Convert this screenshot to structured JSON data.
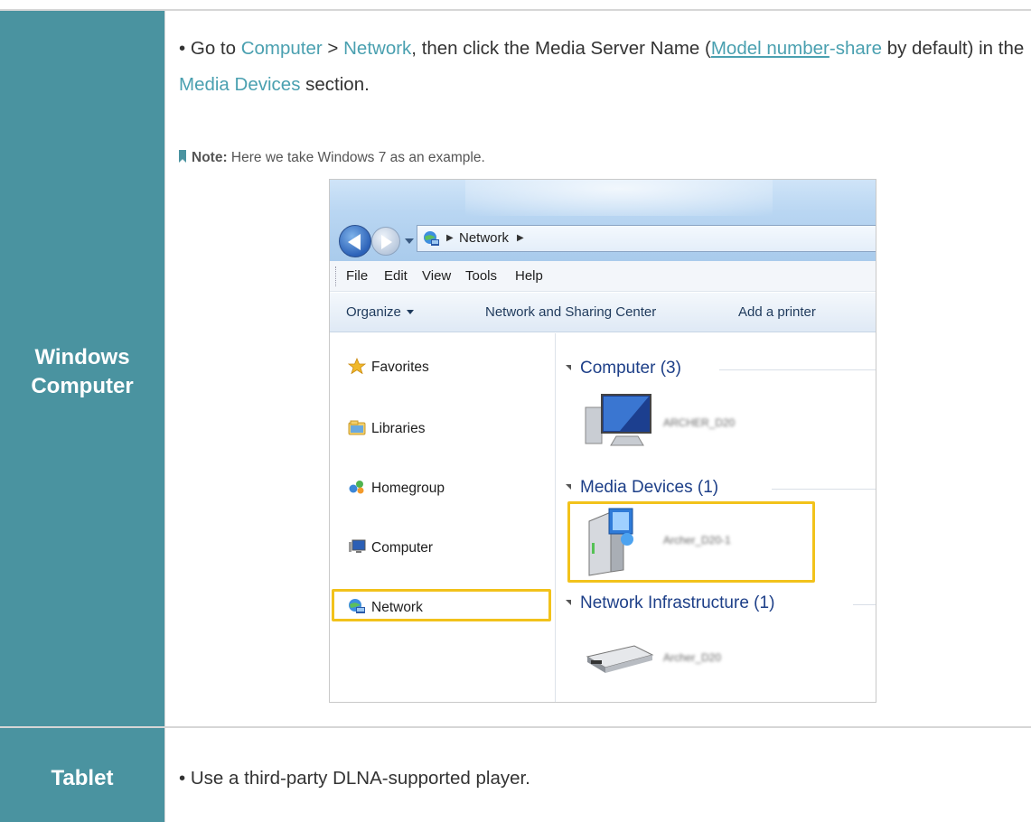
{
  "rows": [
    {
      "category": "Windows Computer",
      "bullet": {
        "parts": [
          {
            "text": "Go to ",
            "style": "plain"
          },
          {
            "text": "Computer",
            "style": "hl"
          },
          {
            "text": " > ",
            "style": "plain"
          },
          {
            "text": "Network",
            "style": "hl"
          },
          {
            "text": ", then click the Media Server Name (",
            "style": "plain"
          },
          {
            "text": "Model number",
            "style": "hl-u"
          },
          {
            "text": "-share",
            "style": "hl"
          },
          {
            "text": " by default) in the ",
            "style": "plain"
          },
          {
            "text": "Media Devices",
            "style": "hl"
          },
          {
            "text": " section.",
            "style": "plain"
          }
        ]
      },
      "note": {
        "label": "Note:",
        "text": "Here we take Windows 7 as an example."
      }
    },
    {
      "category": "Tablet",
      "bullet": {
        "parts": [
          {
            "text": "Use a third-party DLNA-supported player.",
            "style": "plain"
          }
        ]
      }
    }
  ],
  "screenshot": {
    "address_bar": {
      "location": "Network"
    },
    "menu": [
      "File",
      "Edit",
      "View",
      "Tools",
      "Help"
    ],
    "commands": {
      "organize": "Organize",
      "network_sharing": "Network and Sharing Center",
      "add_printer": "Add a printer"
    },
    "nav": {
      "favorites": "Favorites",
      "libraries": "Libraries",
      "homegroup": "Homegroup",
      "computer": "Computer",
      "network": "Network"
    },
    "groups": {
      "computer": "Computer (3)",
      "media_devices": "Media Devices (1)",
      "network_infrastructure": "Network Infrastructure (1)"
    },
    "devices": {
      "computer": "ARCHER_D20",
      "media": "Archer_D20-1",
      "router": "Archer_D20"
    },
    "colors": {
      "highlight": "#f2c21b",
      "accent": "#4a93a0",
      "link": "#4aa0b0"
    }
  }
}
